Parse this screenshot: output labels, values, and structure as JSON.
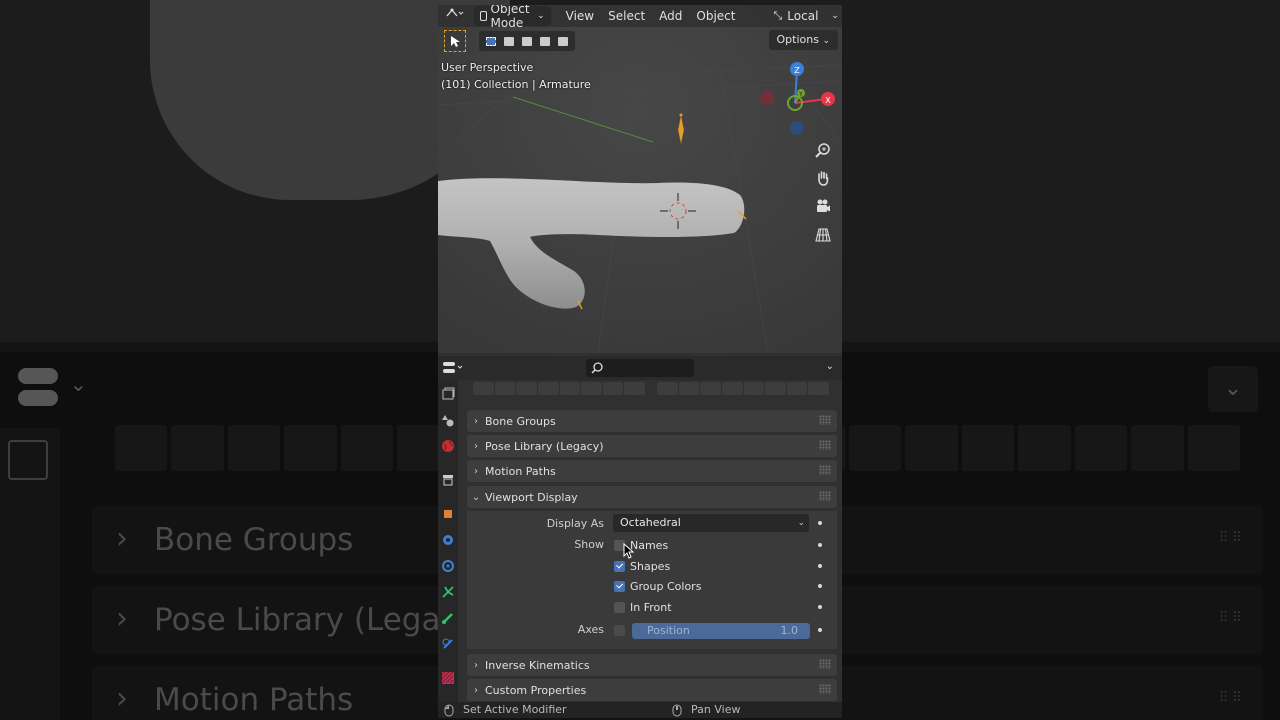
{
  "background": {
    "panels": [
      "Bone Groups",
      "Pose Library (Lega"
    ],
    "panel3": "Motion Paths"
  },
  "viewport": {
    "mode": "Object Mode",
    "menus": [
      "View",
      "Select",
      "Add",
      "Object"
    ],
    "orientation": "Local",
    "options_label": "Options",
    "perspective_label": "User Perspective",
    "collection_label": "(101) Collection | Armature",
    "gizmo_axes": {
      "z": "Z",
      "y": "Y",
      "x": "X"
    }
  },
  "properties": {
    "panels": {
      "bone_groups": "Bone Groups",
      "pose_library": "Pose Library (Legacy)",
      "motion_paths": "Motion Paths",
      "viewport_display": "Viewport Display",
      "inverse_kinematics": "Inverse Kinematics",
      "custom_properties": "Custom Properties"
    },
    "display_as_label": "Display As",
    "display_as_value": "Octahedral",
    "show_label": "Show",
    "show_options": [
      {
        "label": "Names",
        "checked": false
      },
      {
        "label": "Shapes",
        "checked": true
      },
      {
        "label": "Group Colors",
        "checked": true
      },
      {
        "label": "In Front",
        "checked": false
      }
    ],
    "axes_label": "Axes",
    "axes_checked": false,
    "axes_slider_label": "Position",
    "axes_slider_value": "1.0"
  },
  "statusbar": {
    "left_hint": "Set Active Modifier",
    "right_hint": "Pan View"
  },
  "colors": {
    "accent": "#4772b3",
    "axis_x": "#e6374a",
    "axis_y": "#6fa52c",
    "axis_z": "#3a80d6",
    "bone": "#e0a030"
  }
}
